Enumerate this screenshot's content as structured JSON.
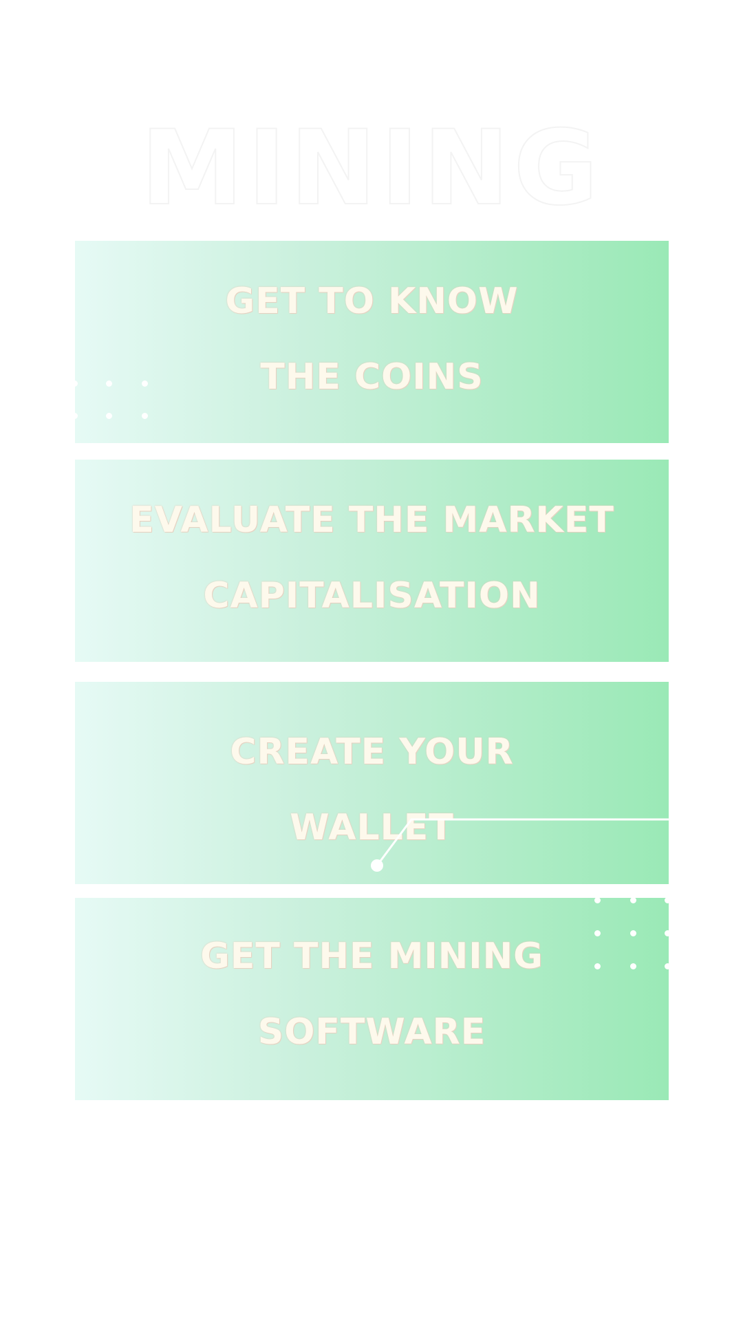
{
  "page": {
    "title": "MINING"
  },
  "steps": [
    {
      "line1": "GET TO KNOW",
      "line2": "THE COINS"
    },
    {
      "line1": "EVALUATE THE MARKET",
      "line2": "CAPITALISATION"
    },
    {
      "line1": "CREATE YOUR",
      "line2": "WALLET"
    },
    {
      "line1": "GET THE  MINING",
      "line2": "SOFTWARE"
    }
  ],
  "colors": {
    "gradient_start": "#e6faf5",
    "gradient_end": "#9ae9b6",
    "text_fill": "#fdf9ec",
    "background": "#ffffff"
  }
}
